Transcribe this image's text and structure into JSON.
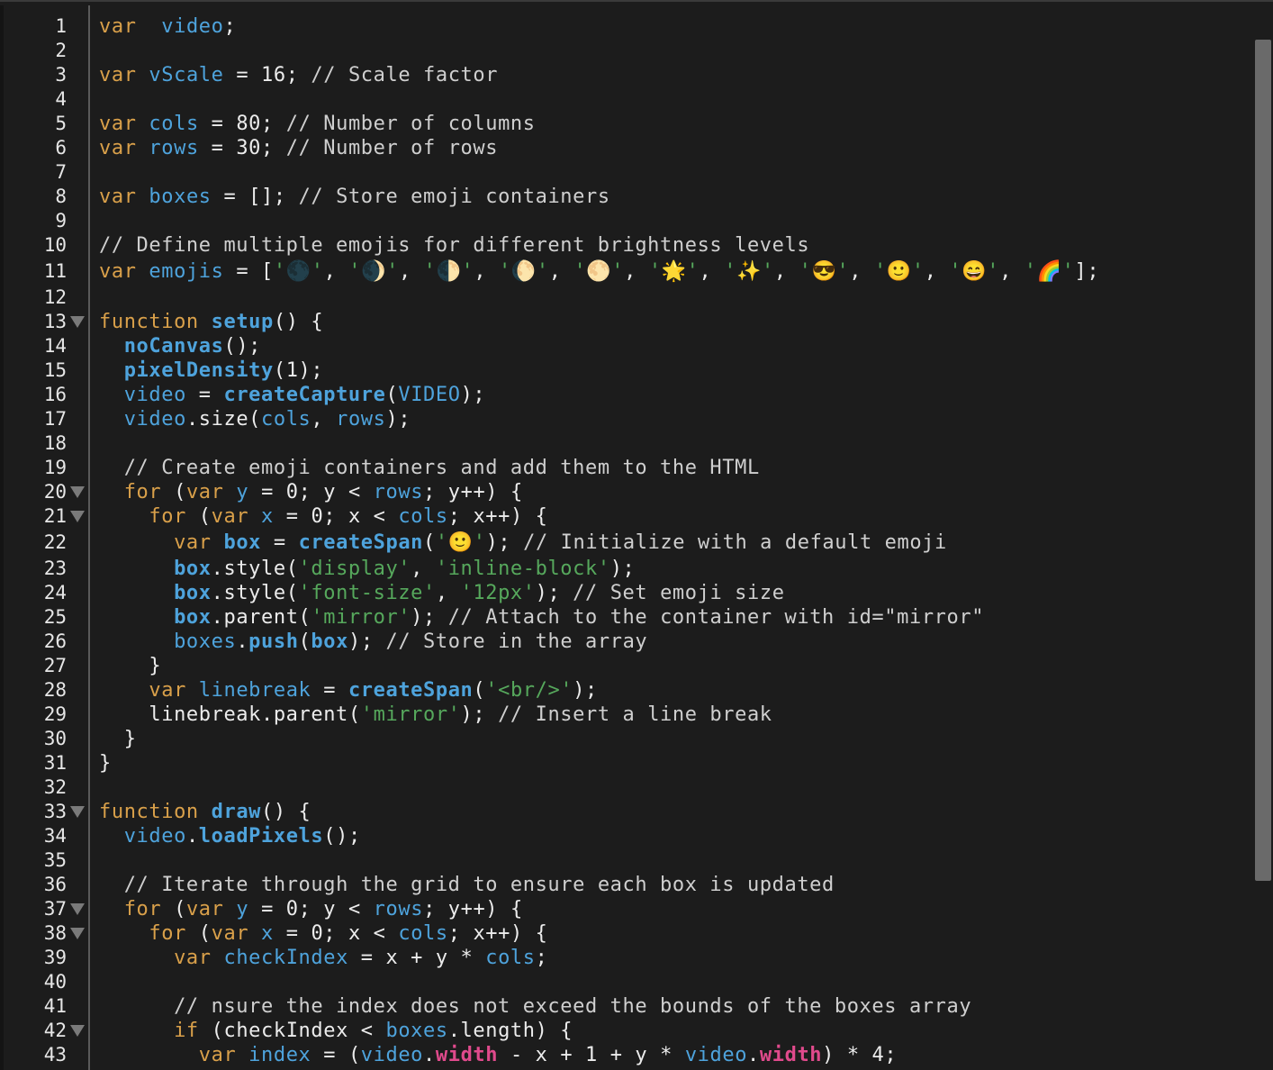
{
  "editor": {
    "lines": [
      {
        "n": "1",
        "fold": false,
        "tokens": [
          [
            "kw",
            "var"
          ],
          [
            "",
            "  "
          ],
          [
            "var",
            "video"
          ],
          [
            "",
            ";"
          ]
        ]
      },
      {
        "n": "2",
        "fold": false,
        "tokens": []
      },
      {
        "n": "3",
        "fold": false,
        "tokens": [
          [
            "kw",
            "var"
          ],
          [
            "",
            " "
          ],
          [
            "var",
            "vScale"
          ],
          [
            "",
            " = 16; "
          ],
          [
            "cm",
            "// Scale factor"
          ]
        ]
      },
      {
        "n": "4",
        "fold": false,
        "tokens": []
      },
      {
        "n": "5",
        "fold": false,
        "tokens": [
          [
            "kw",
            "var"
          ],
          [
            "",
            " "
          ],
          [
            "var",
            "cols"
          ],
          [
            "",
            " = 80; "
          ],
          [
            "cm",
            "// Number of columns"
          ]
        ]
      },
      {
        "n": "6",
        "fold": false,
        "tokens": [
          [
            "kw",
            "var"
          ],
          [
            "",
            " "
          ],
          [
            "var",
            "rows"
          ],
          [
            "",
            " = 30; "
          ],
          [
            "cm",
            "// Number of rows"
          ]
        ]
      },
      {
        "n": "7",
        "fold": false,
        "tokens": []
      },
      {
        "n": "8",
        "fold": false,
        "tokens": [
          [
            "kw",
            "var"
          ],
          [
            "",
            " "
          ],
          [
            "var",
            "boxes"
          ],
          [
            "",
            " = []; "
          ],
          [
            "cm",
            "// Store emoji containers"
          ]
        ]
      },
      {
        "n": "9",
        "fold": false,
        "tokens": []
      },
      {
        "n": "10",
        "fold": false,
        "tokens": [
          [
            "cm",
            "// Define multiple emojis for different brightness levels"
          ]
        ]
      },
      {
        "n": "11",
        "fold": false,
        "tall": true,
        "tokens": [
          [
            "kw",
            "var"
          ],
          [
            "",
            " "
          ],
          [
            "var",
            "emojis"
          ],
          [
            "",
            " = ["
          ],
          [
            "str",
            "'🌑'"
          ],
          [
            "",
            ", "
          ],
          [
            "str",
            "'🌒'"
          ],
          [
            "",
            ", "
          ],
          [
            "str",
            "'🌓'"
          ],
          [
            "",
            ", "
          ],
          [
            "str",
            "'🌔'"
          ],
          [
            "",
            ", "
          ],
          [
            "str",
            "'🌕'"
          ],
          [
            "",
            ", "
          ],
          [
            "str",
            "'🌟'"
          ],
          [
            "",
            ", "
          ],
          [
            "str",
            "'✨'"
          ],
          [
            "",
            ", "
          ],
          [
            "str",
            "'😎'"
          ],
          [
            "",
            ", "
          ],
          [
            "str",
            "'🙂'"
          ],
          [
            "",
            ", "
          ],
          [
            "str",
            "'😄'"
          ],
          [
            "",
            ", "
          ],
          [
            "str",
            "'🌈'"
          ],
          [
            "",
            "];"
          ]
        ]
      },
      {
        "n": "12",
        "fold": false,
        "tokens": []
      },
      {
        "n": "13",
        "fold": true,
        "tokens": [
          [
            "kw",
            "function"
          ],
          [
            "",
            " "
          ],
          [
            "fn",
            "setup"
          ],
          [
            "",
            "() {"
          ]
        ]
      },
      {
        "n": "14",
        "fold": false,
        "tokens": [
          [
            "",
            "  "
          ],
          [
            "fn",
            "noCanvas"
          ],
          [
            "",
            "();"
          ]
        ]
      },
      {
        "n": "15",
        "fold": false,
        "tokens": [
          [
            "",
            "  "
          ],
          [
            "fn",
            "pixelDensity"
          ],
          [
            "",
            "(1);"
          ]
        ]
      },
      {
        "n": "16",
        "fold": false,
        "tokens": [
          [
            "",
            "  "
          ],
          [
            "var",
            "video"
          ],
          [
            "",
            " = "
          ],
          [
            "fn",
            "createCapture"
          ],
          [
            "",
            "("
          ],
          [
            "cst",
            "VIDEO"
          ],
          [
            "",
            ");"
          ]
        ]
      },
      {
        "n": "17",
        "fold": false,
        "tokens": [
          [
            "",
            "  "
          ],
          [
            "var",
            "video"
          ],
          [
            "",
            ".size("
          ],
          [
            "var",
            "cols"
          ],
          [
            "",
            ", "
          ],
          [
            "var",
            "rows"
          ],
          [
            "",
            ");"
          ]
        ]
      },
      {
        "n": "18",
        "fold": false,
        "tokens": []
      },
      {
        "n": "19",
        "fold": false,
        "tokens": [
          [
            "",
            "  "
          ],
          [
            "cm",
            "// Create emoji containers and add them to the HTML"
          ]
        ]
      },
      {
        "n": "20",
        "fold": true,
        "tokens": [
          [
            "",
            "  "
          ],
          [
            "kw",
            "for"
          ],
          [
            "",
            " ("
          ],
          [
            "kw",
            "var"
          ],
          [
            "",
            " "
          ],
          [
            "var",
            "y"
          ],
          [
            "",
            " = 0; y < "
          ],
          [
            "var",
            "rows"
          ],
          [
            "",
            "; y++) {"
          ]
        ]
      },
      {
        "n": "21",
        "fold": true,
        "tokens": [
          [
            "",
            "    "
          ],
          [
            "kw",
            "for"
          ],
          [
            "",
            " ("
          ],
          [
            "kw",
            "var"
          ],
          [
            "",
            " "
          ],
          [
            "var",
            "x"
          ],
          [
            "",
            " = 0; x < "
          ],
          [
            "var",
            "cols"
          ],
          [
            "",
            "; x++) {"
          ]
        ]
      },
      {
        "n": "22",
        "fold": false,
        "tall": true,
        "tokens": [
          [
            "",
            "      "
          ],
          [
            "kw",
            "var"
          ],
          [
            "",
            " "
          ],
          [
            "fn",
            "box"
          ],
          [
            "",
            " = "
          ],
          [
            "fn",
            "createSpan"
          ],
          [
            "",
            "("
          ],
          [
            "str",
            "'🙂'"
          ],
          [
            "",
            "); "
          ],
          [
            "cm",
            "// Initialize with a default emoji"
          ]
        ]
      },
      {
        "n": "23",
        "fold": false,
        "tokens": [
          [
            "",
            "      "
          ],
          [
            "fn",
            "box"
          ],
          [
            "",
            ".style("
          ],
          [
            "str",
            "'display'"
          ],
          [
            "",
            ", "
          ],
          [
            "str",
            "'inline-block'"
          ],
          [
            "",
            ");"
          ]
        ]
      },
      {
        "n": "24",
        "fold": false,
        "tokens": [
          [
            "",
            "      "
          ],
          [
            "fn",
            "box"
          ],
          [
            "",
            ".style("
          ],
          [
            "str",
            "'font-size'"
          ],
          [
            "",
            ", "
          ],
          [
            "str",
            "'12px'"
          ],
          [
            "",
            "); "
          ],
          [
            "cm",
            "// Set emoji size"
          ]
        ]
      },
      {
        "n": "25",
        "fold": false,
        "tokens": [
          [
            "",
            "      "
          ],
          [
            "fn",
            "box"
          ],
          [
            "",
            ".parent("
          ],
          [
            "str",
            "'mirror'"
          ],
          [
            "",
            "); "
          ],
          [
            "cm",
            "// Attach to the container with id=\"mirror\""
          ]
        ]
      },
      {
        "n": "26",
        "fold": false,
        "tokens": [
          [
            "",
            "      "
          ],
          [
            "var",
            "boxes"
          ],
          [
            "",
            "."
          ],
          [
            "fn",
            "push"
          ],
          [
            "",
            "("
          ],
          [
            "fn",
            "box"
          ],
          [
            "",
            "); "
          ],
          [
            "cm",
            "// Store in the array"
          ]
        ]
      },
      {
        "n": "27",
        "fold": false,
        "tokens": [
          [
            "",
            "    }"
          ]
        ]
      },
      {
        "n": "28",
        "fold": false,
        "tokens": [
          [
            "",
            "    "
          ],
          [
            "kw",
            "var"
          ],
          [
            "",
            " "
          ],
          [
            "var",
            "linebreak"
          ],
          [
            "",
            " = "
          ],
          [
            "fn",
            "createSpan"
          ],
          [
            "",
            "("
          ],
          [
            "str",
            "'<br/>'"
          ],
          [
            "",
            ");"
          ]
        ]
      },
      {
        "n": "29",
        "fold": false,
        "tokens": [
          [
            "",
            "    linebreak.parent("
          ],
          [
            "str",
            "'mirror'"
          ],
          [
            "",
            "); "
          ],
          [
            "cm",
            "// Insert a line break"
          ]
        ]
      },
      {
        "n": "30",
        "fold": false,
        "tokens": [
          [
            "",
            "  }"
          ]
        ]
      },
      {
        "n": "31",
        "fold": false,
        "tokens": [
          [
            "",
            "}"
          ]
        ]
      },
      {
        "n": "32",
        "fold": false,
        "tokens": []
      },
      {
        "n": "33",
        "fold": true,
        "tokens": [
          [
            "kw",
            "function"
          ],
          [
            "",
            " "
          ],
          [
            "fn",
            "draw"
          ],
          [
            "",
            "() {"
          ]
        ]
      },
      {
        "n": "34",
        "fold": false,
        "tokens": [
          [
            "",
            "  "
          ],
          [
            "var",
            "video"
          ],
          [
            "",
            "."
          ],
          [
            "fn",
            "loadPixels"
          ],
          [
            "",
            "();"
          ]
        ]
      },
      {
        "n": "35",
        "fold": false,
        "tokens": []
      },
      {
        "n": "36",
        "fold": false,
        "tokens": [
          [
            "",
            "  "
          ],
          [
            "cm",
            "// Iterate through the grid to ensure each box is updated"
          ]
        ]
      },
      {
        "n": "37",
        "fold": true,
        "tokens": [
          [
            "",
            "  "
          ],
          [
            "kw",
            "for"
          ],
          [
            "",
            " ("
          ],
          [
            "kw",
            "var"
          ],
          [
            "",
            " "
          ],
          [
            "var",
            "y"
          ],
          [
            "",
            " = 0; y < "
          ],
          [
            "var",
            "rows"
          ],
          [
            "",
            "; y++) {"
          ]
        ]
      },
      {
        "n": "38",
        "fold": true,
        "tokens": [
          [
            "",
            "    "
          ],
          [
            "kw",
            "for"
          ],
          [
            "",
            " ("
          ],
          [
            "kw",
            "var"
          ],
          [
            "",
            " "
          ],
          [
            "var",
            "x"
          ],
          [
            "",
            " = 0; x < "
          ],
          [
            "var",
            "cols"
          ],
          [
            "",
            "; x++) {"
          ]
        ]
      },
      {
        "n": "39",
        "fold": false,
        "tokens": [
          [
            "",
            "      "
          ],
          [
            "kw",
            "var"
          ],
          [
            "",
            " "
          ],
          [
            "var",
            "checkIndex"
          ],
          [
            "",
            " = x + y * "
          ],
          [
            "var",
            "cols"
          ],
          [
            "",
            ";"
          ]
        ]
      },
      {
        "n": "40",
        "fold": false,
        "tokens": []
      },
      {
        "n": "41",
        "fold": false,
        "tokens": [
          [
            "",
            "      "
          ],
          [
            "cm",
            "// nsure the index does not exceed the bounds of the boxes array"
          ]
        ]
      },
      {
        "n": "42",
        "fold": true,
        "tokens": [
          [
            "",
            "      "
          ],
          [
            "kw",
            "if"
          ],
          [
            "",
            " (checkIndex < "
          ],
          [
            "var",
            "boxes"
          ],
          [
            "",
            ".length) {"
          ]
        ]
      },
      {
        "n": "43",
        "fold": false,
        "tokens": [
          [
            "",
            "        "
          ],
          [
            "kw",
            "var"
          ],
          [
            "",
            " "
          ],
          [
            "var",
            "index"
          ],
          [
            "",
            " = ("
          ],
          [
            "var",
            "video"
          ],
          [
            "",
            "."
          ],
          [
            "pk",
            "width"
          ],
          [
            "",
            " - x + 1 + y * "
          ],
          [
            "var",
            "video"
          ],
          [
            "",
            "."
          ],
          [
            "pk",
            "width"
          ],
          [
            "",
            ") * 4;"
          ]
        ]
      }
    ]
  }
}
